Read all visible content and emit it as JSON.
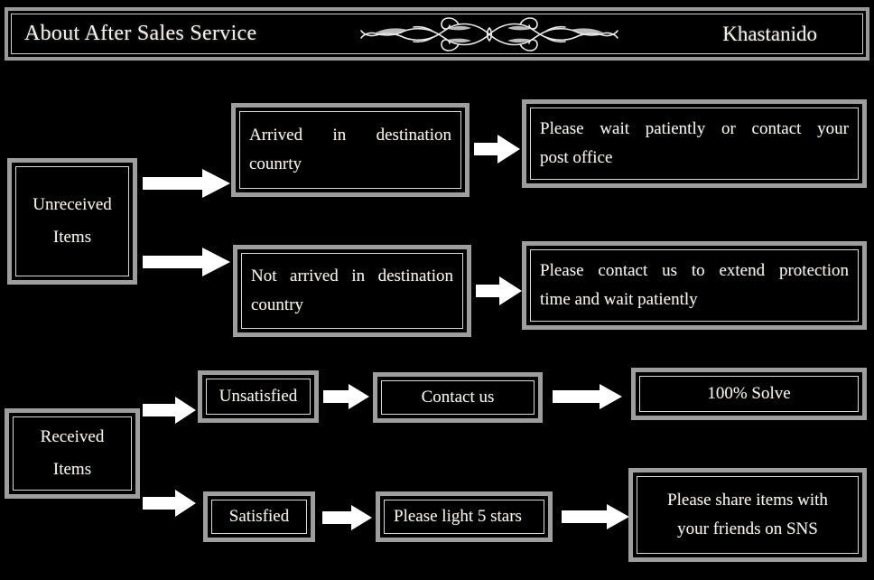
{
  "header": {
    "title": "About After Sales Service",
    "brand": "Khastanido",
    "ornament_icon": "flourish-ornament-icon"
  },
  "colors": {
    "background": "#000000",
    "box_border_outer": "#9e9e9e",
    "box_border_inner": "#d8d8d8",
    "text": "#f2f0ec",
    "arrow": "#ffffff"
  },
  "flow": {
    "nodes": {
      "unreceived_items": {
        "line1": "Unreceived",
        "line2": "Items"
      },
      "arrived_destination": {
        "line1": "Arrived in destination",
        "line2": "counrty"
      },
      "wait_post_office": {
        "line1": "Please wait patiently or contact your",
        "line2": "post office"
      },
      "not_arrived_destination": {
        "line1": "Not arrived in destination",
        "line2": "country"
      },
      "extend_protection": {
        "line1": "Please contact us to extend protection",
        "line2": "time and wait patiently"
      },
      "received_items": {
        "line1": "Received",
        "line2": "Items"
      },
      "unsatisfied": {
        "line1": "Unsatisfied"
      },
      "contact_us": {
        "line1": "Contact us"
      },
      "solve": {
        "line1": "100% Solve"
      },
      "satisfied": {
        "line1": "Satisfied"
      },
      "light_5_stars": {
        "line1": "Please light 5 stars"
      },
      "share_items": {
        "line1": "Please share items with",
        "line2": "your friends on SNS"
      }
    },
    "arrow_icons": [
      "arrow-right-icon-unreceived-to-arrived",
      "arrow-right-icon-arrived-to-wait",
      "arrow-right-icon-unreceived-to-notarrived",
      "arrow-right-icon-notarrived-to-extend",
      "arrow-right-icon-received-to-unsatisfied",
      "arrow-right-icon-unsatisfied-to-contact",
      "arrow-right-icon-contact-to-solve",
      "arrow-right-icon-received-to-satisfied",
      "arrow-right-icon-satisfied-to-stars",
      "arrow-right-icon-stars-to-share"
    ]
  }
}
